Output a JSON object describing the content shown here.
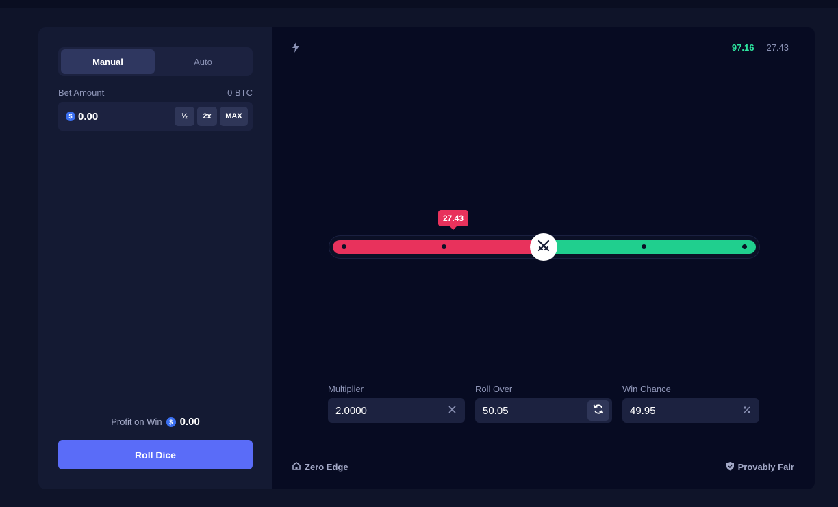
{
  "mode_toggle": {
    "manual_label": "Manual",
    "auto_label": "Auto",
    "active": "Manual"
  },
  "bet": {
    "label": "Bet Amount",
    "btc_value": "0 BTC",
    "currency_icon": "$",
    "amount": "0.00",
    "half_label": "½",
    "double_label": "2x",
    "max_label": "MAX"
  },
  "profit": {
    "label": "Profit on Win",
    "currency_icon": "$",
    "value": "0.00"
  },
  "roll_button": {
    "label": "Roll Dice"
  },
  "history": {
    "win": "97.16",
    "loss": "27.43"
  },
  "slider": {
    "result_tag": "27.43",
    "roll_over_fraction": 0.5005
  },
  "fields": {
    "multiplier": {
      "label": "Multiplier",
      "value": "2.0000"
    },
    "roll_over": {
      "label": "Roll Over",
      "value": "50.05"
    },
    "win_chance": {
      "label": "Win Chance",
      "value": "49.95"
    }
  },
  "footer": {
    "zero_edge": "Zero Edge",
    "provably_fair": "Provably Fair"
  },
  "colors": {
    "accent": "#5a6cf8",
    "loss": "#e8325c",
    "win": "#20cf8e",
    "history_win": "#2ee6a0"
  }
}
